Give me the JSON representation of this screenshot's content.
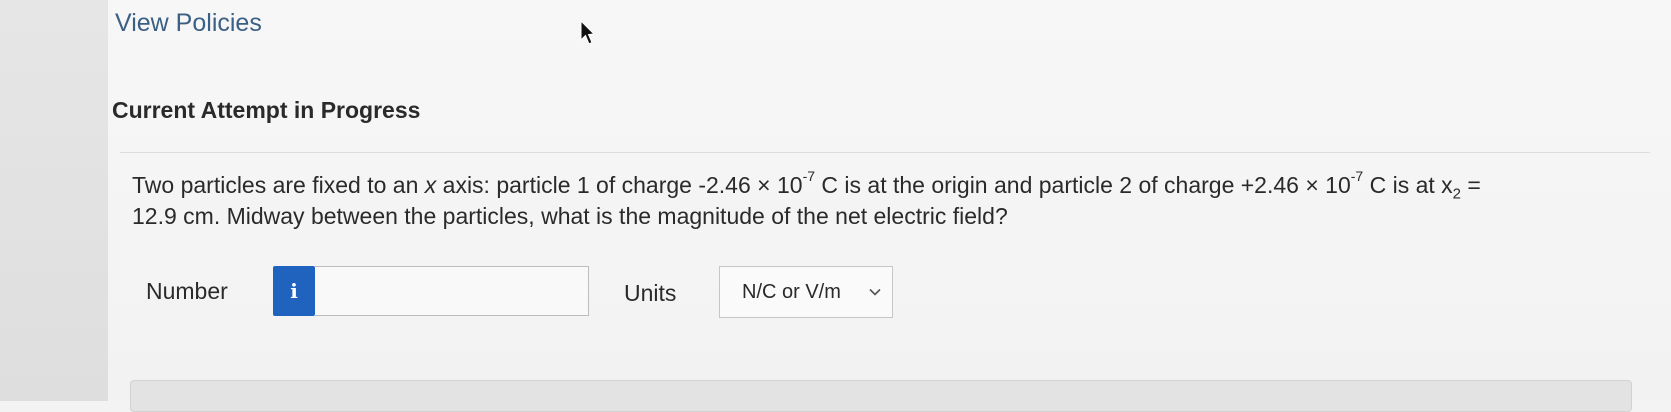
{
  "header": {
    "view_policies": "View Policies"
  },
  "attempt": {
    "title": "Current Attempt in Progress"
  },
  "question": {
    "p1": "Two particles are fixed to an ",
    "x_var": "x",
    "p2": " axis: particle 1 of charge -2.46 × 10",
    "exp1": "-7",
    "p3": " C is at the origin and particle 2 of charge +2.46 × 10",
    "exp2": "-7",
    "p4": " C is at x",
    "sub": "2",
    "p5": " =",
    "line2": "12.9 cm. Midway between the particles, what is the magnitude of the net electric field?"
  },
  "answer": {
    "number_label": "Number",
    "info_icon": "i",
    "number_value": "",
    "units_label": "Units",
    "units_selected": "N/C or V/m"
  },
  "icons": {
    "info": "info-icon",
    "chevron": "chevron-down-icon",
    "cursor": "mouse-pointer-icon"
  },
  "colors": {
    "link": "#3b5f85",
    "info_button": "#1f63bf"
  }
}
